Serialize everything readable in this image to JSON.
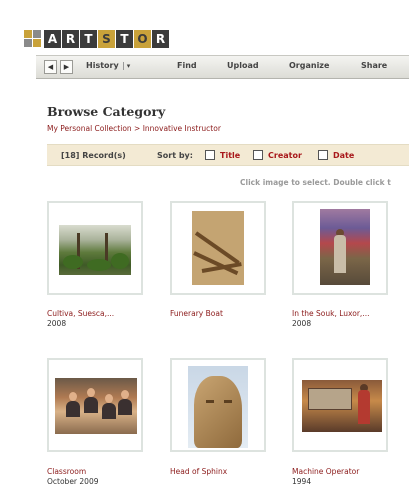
{
  "app": {
    "logo_letters": [
      "A",
      "R",
      "T",
      "S",
      "T",
      "O",
      "R"
    ],
    "accent_color": "#c9a23a",
    "logo_dark": "#3b3b3b"
  },
  "toolbar": {
    "back_icon": "back-arrow-icon",
    "forward_icon": "forward-arrow-icon",
    "history_label": "History",
    "history_dropdown": "▾",
    "find_label": "Find",
    "upload_label": "Upload",
    "organize_label": "Organize",
    "share_label": "Share"
  },
  "header": {
    "title": "Browse Category",
    "breadcrumb": "My Personal Collection > Innovative Instructor"
  },
  "records": {
    "count_label": "[18] Record(s)",
    "sort_label": "Sort by:",
    "sort_options": [
      "Title",
      "Creator",
      "Date"
    ],
    "sort_color": "#a8181b"
  },
  "hint": "Click image to select. Double click t",
  "items": [
    {
      "title": "Cultiva, Suesca,...",
      "date": "2008"
    },
    {
      "title": "Funerary Boat",
      "date": ""
    },
    {
      "title": "In the Souk, Luxor,...",
      "date": "2008"
    },
    {
      "title": "Classroom",
      "date": "October 2009"
    },
    {
      "title": "Head of Sphinx",
      "date": ""
    },
    {
      "title": "Machine Operator",
      "date": "1994"
    }
  ]
}
